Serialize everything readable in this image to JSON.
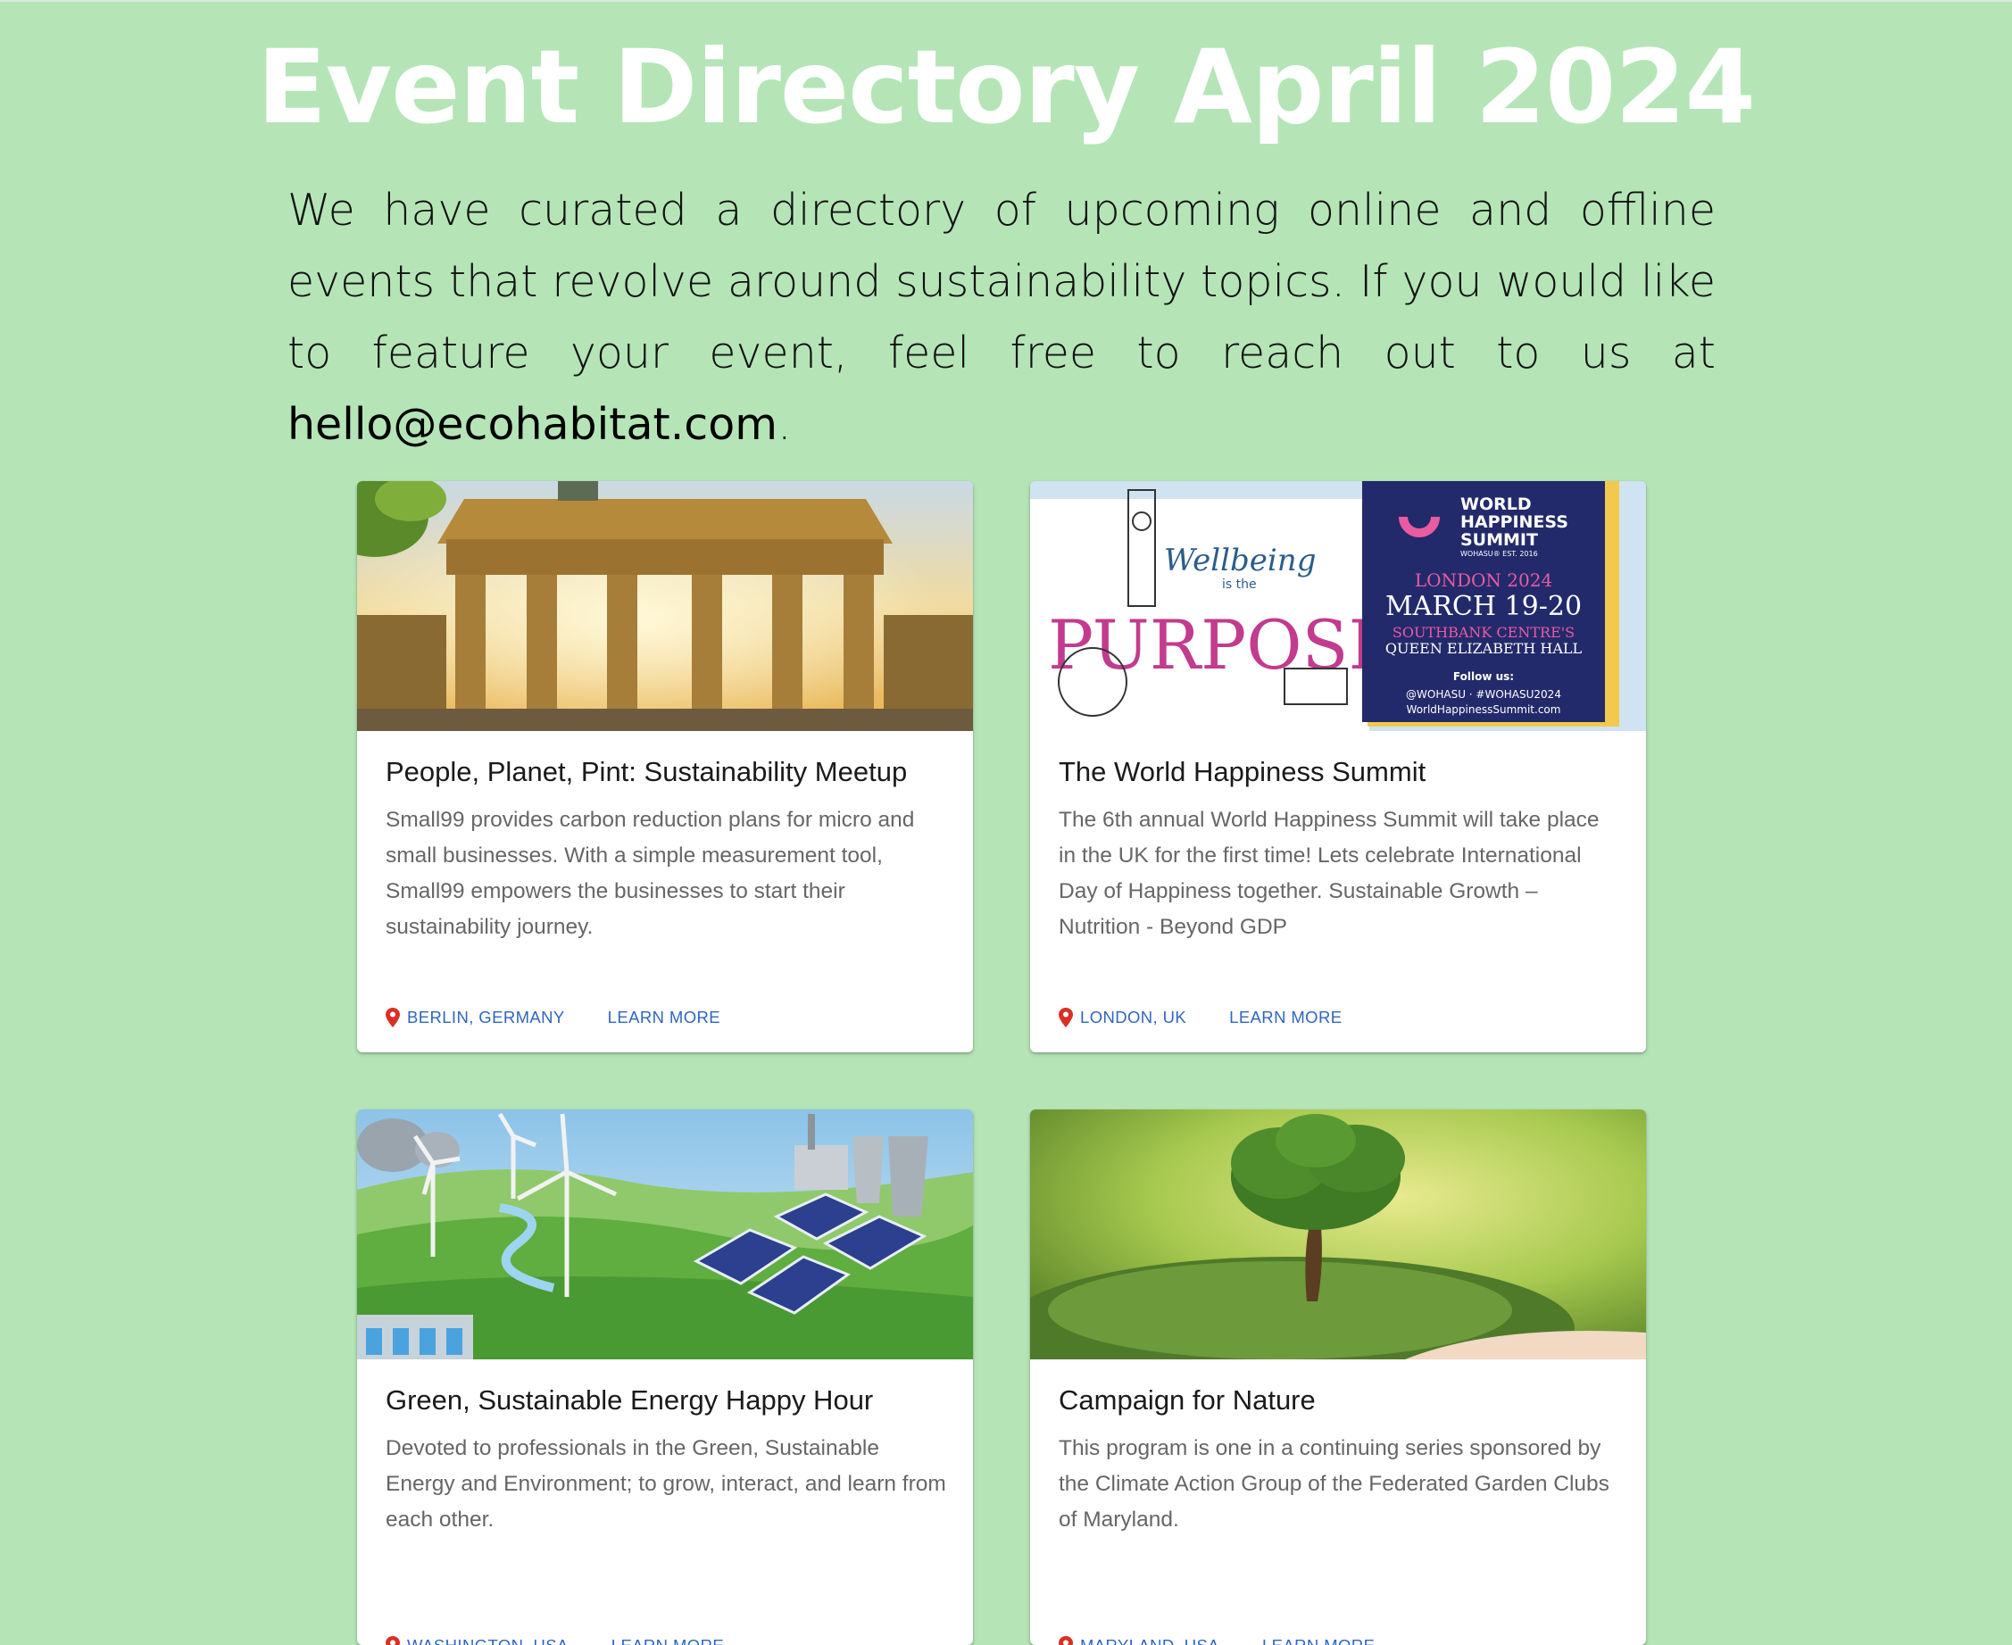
{
  "page": {
    "title": "Event Directory April 2024",
    "intro_text": "We have curated a directory of upcoming online and offline events that revolve around sustainability topics. If you would like to feature your event, feel free to reach out to us at ",
    "email": "hello@ecohabitat.com",
    "intro_end": "."
  },
  "colors": {
    "background": "#b5e5b7",
    "link": "#2f66c1",
    "pin": "#d93025"
  },
  "events": [
    {
      "title": "People, Planet, Pint: Sustainability Meetup",
      "description": "Small99 provides carbon reduction plans for micro and small businesses. With a simple measurement tool, Small99 empowers the businesses to start their sustainability journey.",
      "location": "BERLIN, GERMANY",
      "action": "LEARN MORE",
      "image": "brandenburg-gate-photo"
    },
    {
      "title": "The World Happiness Summit",
      "description": "The 6th annual World Happiness Summit will take place in the UK for the first time! Lets celebrate International Day of Happiness together. Sustainable Growth – Nutrition - Beyond GDP",
      "location": "LONDON, UK",
      "action": "LEARN MORE",
      "image": "world-happiness-summit-poster",
      "poster": {
        "left_script": "Wellbeing",
        "left_small": "is the",
        "left_big": "PURPOSE",
        "brand_line1": "WORLD",
        "brand_line2": "HAPPINESS",
        "brand_line3": "SUMMIT",
        "brand_sub": "WOHASU® EST. 2016",
        "city": "LONDON 2024",
        "dates": "MARCH 19-20",
        "venue1": "SOUTHBANK CENTRE'S",
        "venue2": "QUEEN ELIZABETH HALL",
        "follow": "Follow us:",
        "handles": "@WOHASU · #WOHASU2024",
        "site": "WorldHappinessSummit.com"
      }
    },
    {
      "title": "Green, Sustainable Energy Happy Hour",
      "description": "Devoted to professionals in the Green, Sustainable Energy and Environment; to grow, interact, and learn from each other.",
      "location": "WASHINGTON, USA",
      "action": "LEARN MORE",
      "image": "renewable-energy-illustration"
    },
    {
      "title": "Campaign for Nature",
      "description": "This program is one in a continuing series sponsored by the Climate Action Group of the Federated Garden Clubs of Maryland.",
      "location": "MARYLAND, USA",
      "action": "LEARN MORE",
      "image": "tree-in-hands-photo"
    }
  ]
}
